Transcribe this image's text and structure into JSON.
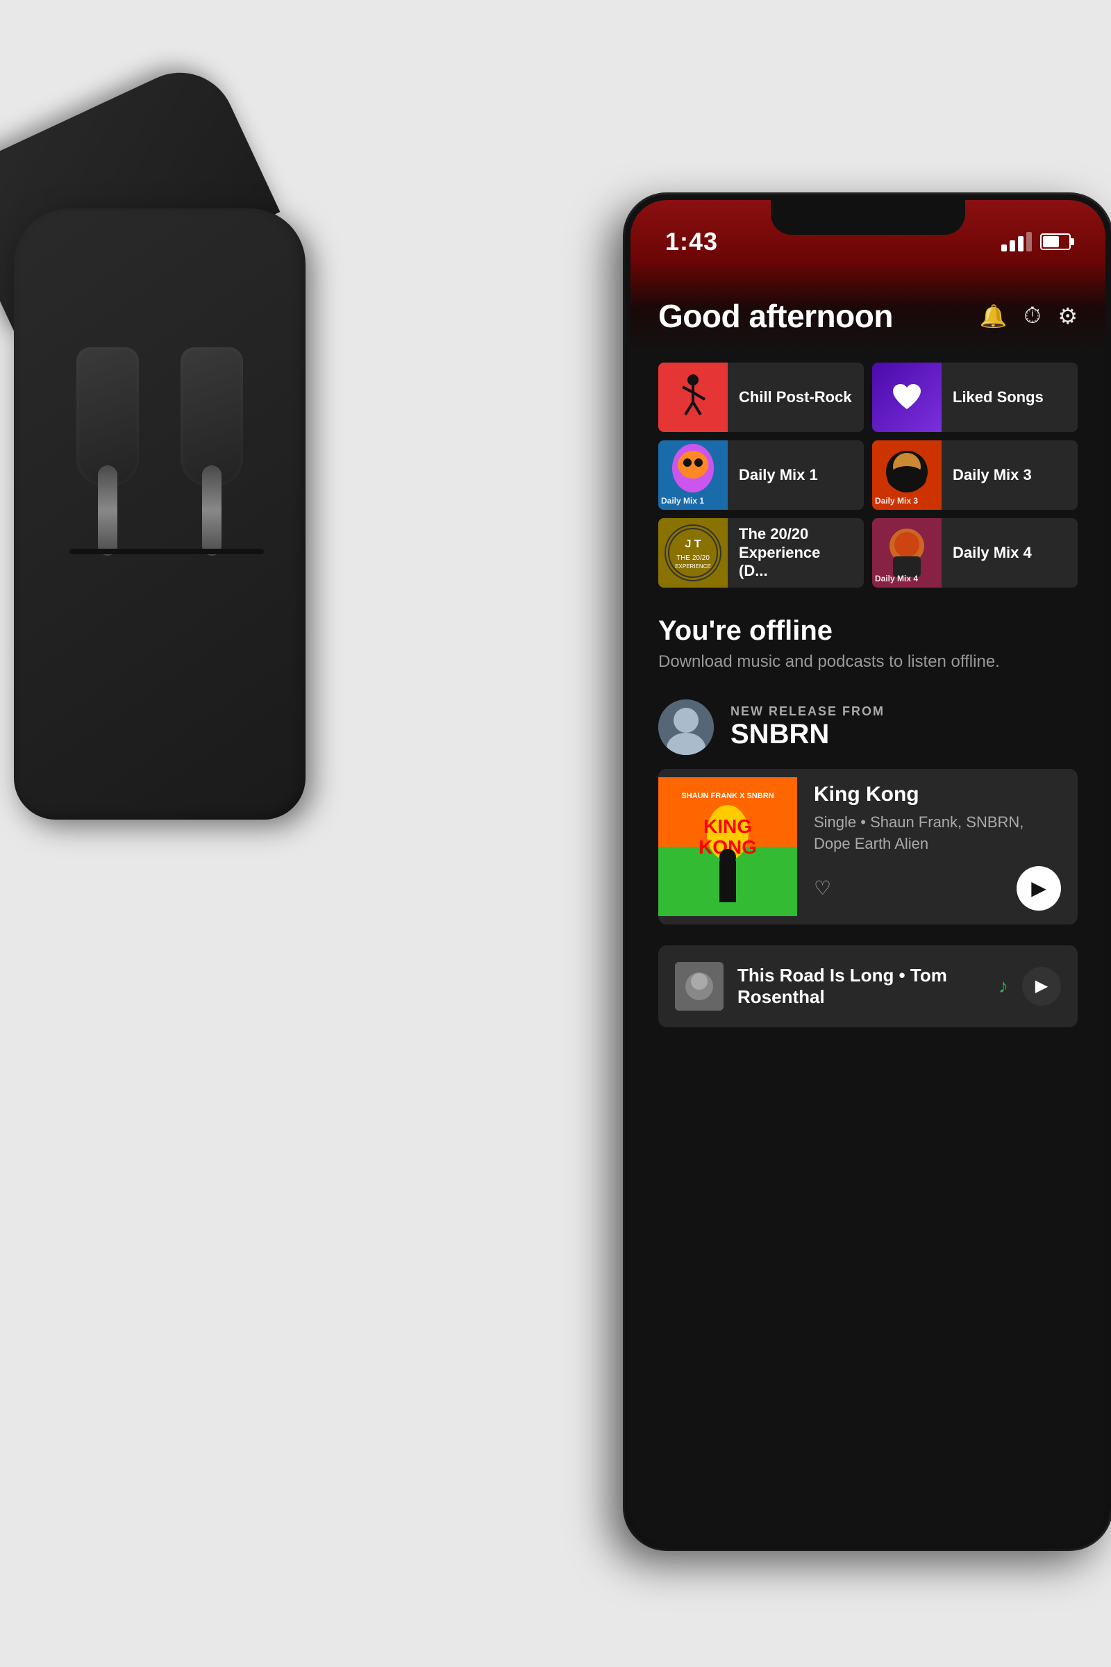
{
  "surface": {
    "bg_color": "#e0e0e0"
  },
  "status_bar": {
    "time": "1:43",
    "signal_label": "signal",
    "battery_label": "battery"
  },
  "header": {
    "greeting": "Good afternoon",
    "bell_icon": "🔔",
    "history_icon": "🕐",
    "settings_icon": "⚙️"
  },
  "grid_items": [
    {
      "id": "chill-postrock",
      "label": "Chill Post-Rock",
      "art_type": "chill",
      "art_bg": "#e03030"
    },
    {
      "id": "liked-songs",
      "label": "Liked Songs",
      "art_type": "liked",
      "art_bg": "linear"
    },
    {
      "id": "daily-mix-1",
      "label": "Daily Mix 1",
      "art_type": "daily1",
      "art_bg": "#1a6baa"
    },
    {
      "id": "daily-mix-3",
      "label": "Daily Mix 3",
      "art_type": "daily3",
      "art_bg": "#cc3300"
    },
    {
      "id": "2020-experience",
      "label": "The 20/20 Experience (D...",
      "art_type": "2020",
      "art_bg": "#c8a800"
    },
    {
      "id": "daily-mix-4",
      "label": "Daily Mix 4",
      "art_type": "daily4",
      "art_bg": "#aa2266"
    }
  ],
  "offline": {
    "title": "You're offline",
    "description": "Download music and podcasts to listen offline."
  },
  "new_release": {
    "label": "NEW RELEASE FROM",
    "artist": "SNBRN",
    "song_title": "King Kong",
    "song_subtitle": "Single • Shaun Frank, SNBRN,\nDope Earth Alien"
  },
  "bottom_track": {
    "name": "This Road Is Long • Tom Rosenthal"
  },
  "icons": {
    "bell": "🔔",
    "history": "⏱",
    "settings": "⚙",
    "heart": "♡",
    "play": "▶",
    "spotify_logo": "♪"
  }
}
